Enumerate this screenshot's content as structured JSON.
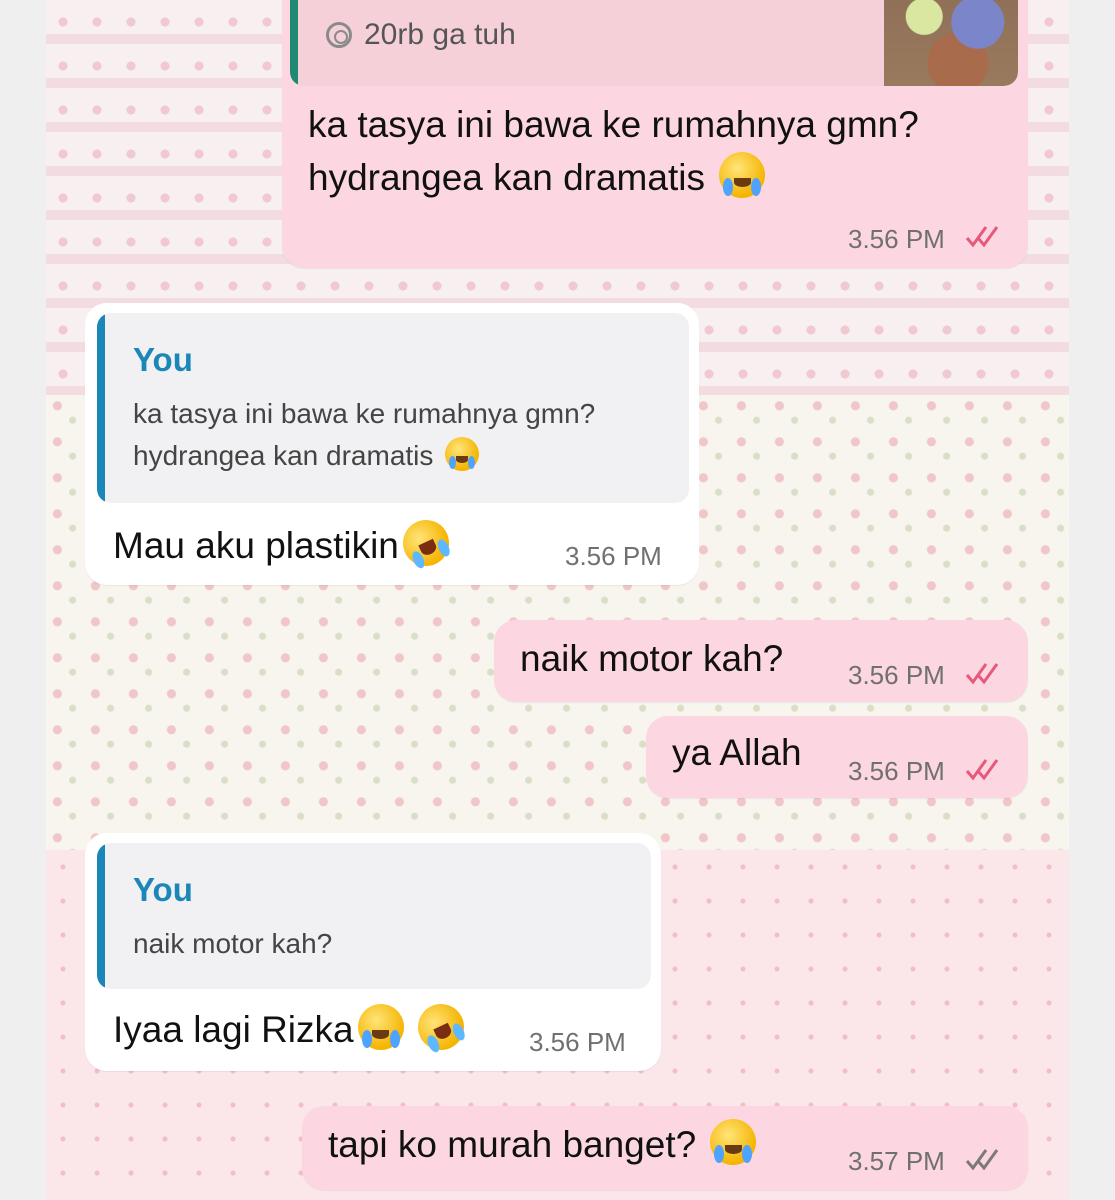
{
  "colors": {
    "outgoing_bubble": "#fcd7e1",
    "incoming_bubble": "#ffffff",
    "quote_accent": "#1a87b8",
    "read_ticks": "#e8587c",
    "sent_ticks": "#7a7a7a"
  },
  "messages": [
    {
      "direction": "outgoing",
      "quote": {
        "text": "20rb ga tuh",
        "icon": "view-once-icon",
        "has_thumbnail": true
      },
      "lines": [
        "ka tasya ini bawa ke rumahnya gmn?",
        "hydrangea kan dramatis"
      ],
      "emoji": "loudly-crying-face",
      "time": "3.56 PM",
      "status": "read"
    },
    {
      "direction": "incoming",
      "quote": {
        "name": "You",
        "lines": [
          "ka tasya ini bawa ke rumahnya gmn?",
          "hydrangea kan dramatis"
        ]
      },
      "text": "Mau aku plastikin",
      "emoji": "rofl-face",
      "time": "3.56 PM"
    },
    {
      "direction": "outgoing",
      "text": "naik motor kah?",
      "time": "3.56 PM",
      "status": "read"
    },
    {
      "direction": "outgoing",
      "text": "ya Allah",
      "time": "3.56 PM",
      "status": "read"
    },
    {
      "direction": "incoming",
      "quote": {
        "name": "You",
        "lines": [
          "naik motor kah?"
        ]
      },
      "text": "Iyaa lagi Rizka",
      "emoji": "loudly-crying-face rofl-face",
      "time": "3.56 PM"
    },
    {
      "direction": "outgoing",
      "text": "tapi ko murah banget?",
      "emoji": "loudly-crying-face",
      "time": "3.57 PM",
      "status": "delivered"
    }
  ]
}
